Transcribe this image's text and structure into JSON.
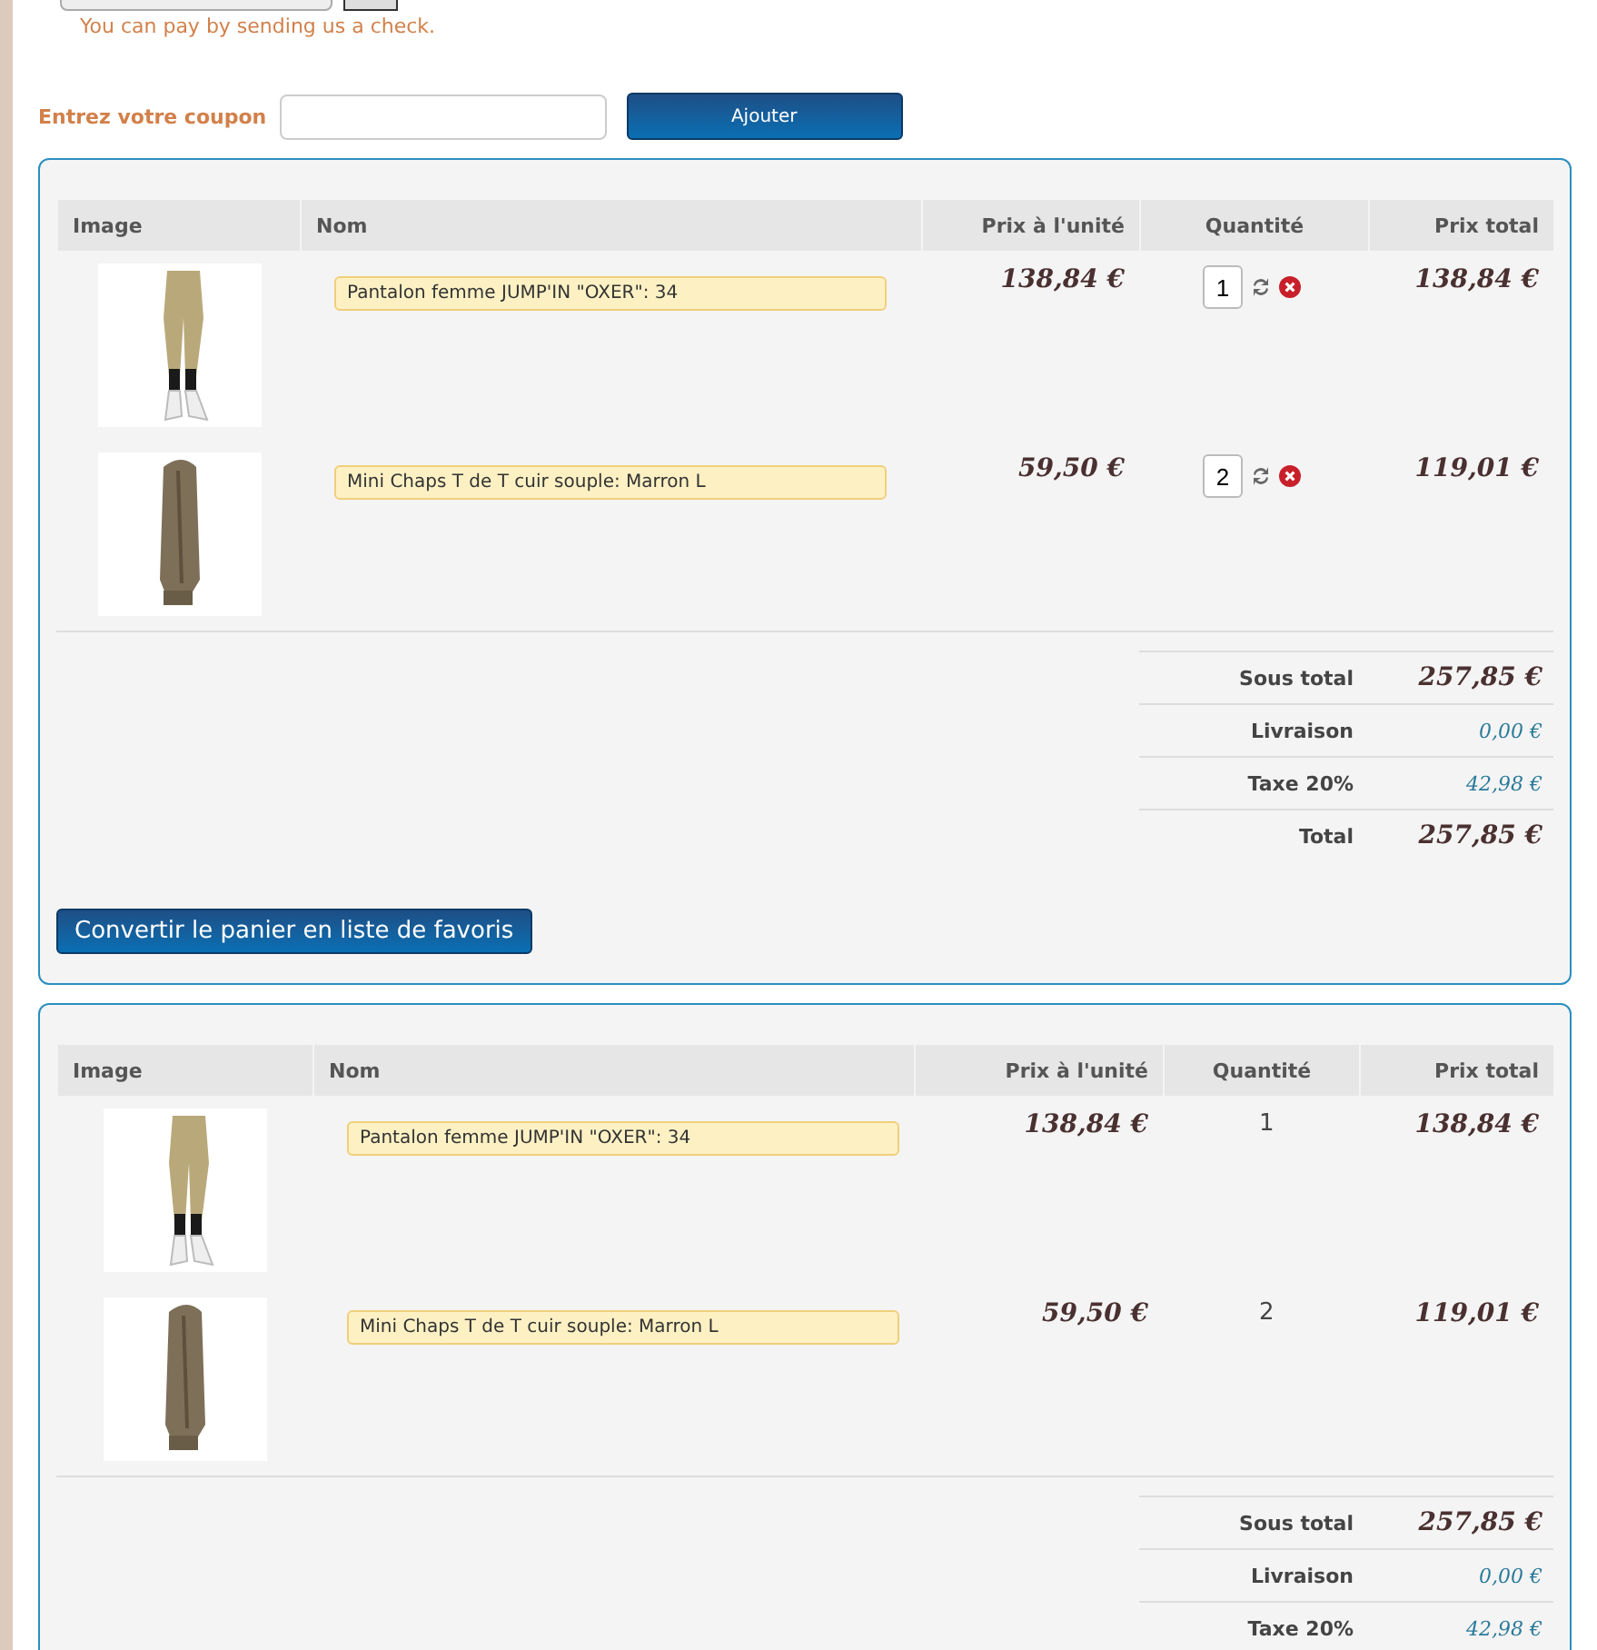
{
  "payment_note": "You can pay by sending us a check.",
  "coupon": {
    "label": "Entrez votre coupon",
    "button": "Ajouter"
  },
  "carts": [
    {
      "kind": "editable",
      "columns": [
        "Image",
        "Nom",
        "Prix à l'unité",
        "Quantité",
        "Prix total"
      ],
      "rows": [
        {
          "name": "Pantalon femme JUMP'IN \"OXER\": 34",
          "unit_price": "138,84 €",
          "quantity": "1",
          "total": "138,84 €"
        },
        {
          "name": "Mini Chaps T de T cuir souple: Marron L",
          "unit_price": "59,50 €",
          "quantity": "2",
          "total": "119,01 €"
        }
      ],
      "summary": [
        {
          "label": "Sous total",
          "value": "257,85 €",
          "kind": "main"
        },
        {
          "label": "Livraison",
          "value": "0,00 €",
          "kind": "minor"
        },
        {
          "label": "Taxe 20%",
          "value": "42,98 €",
          "kind": "minor"
        },
        {
          "label": "Total",
          "value": "257,85 €",
          "kind": "main"
        }
      ],
      "button": "Convertir le panier en liste de favoris"
    },
    {
      "kind": "readonly",
      "columns": [
        "Image",
        "Nom",
        "Prix à l'unité",
        "Quantité",
        "Prix total"
      ],
      "rows": [
        {
          "name": "Pantalon femme JUMP'IN \"OXER\": 34",
          "unit_price": "138,84 €",
          "quantity": "1",
          "total": "138,84 €"
        },
        {
          "name": "Mini Chaps T de T cuir souple: Marron L",
          "unit_price": "59,50 €",
          "quantity": "2",
          "total": "119,01 €"
        }
      ],
      "summary": [
        {
          "label": "Sous total",
          "value": "257,85 €",
          "kind": "main"
        },
        {
          "label": "Livraison",
          "value": "0,00 €",
          "kind": "minor"
        },
        {
          "label": "Taxe 20%",
          "value": "42,98 €",
          "kind": "minor"
        }
      ]
    }
  ]
}
